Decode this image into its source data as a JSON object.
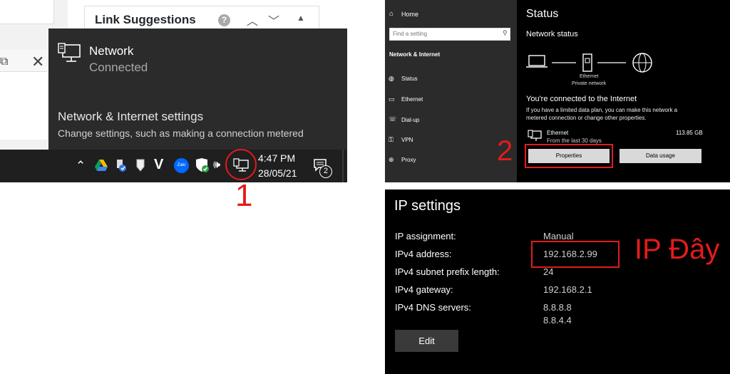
{
  "panel1": {
    "link_suggestions_title": "Link Suggestions",
    "help_icon": "?",
    "flyout": {
      "network_title": "Network",
      "network_status": "Connected",
      "settings_link": "Network & Internet settings",
      "settings_sub": "Change settings, such as making a connection metered"
    },
    "taskbar": {
      "time": "4:47 PM",
      "date": "28/05/21",
      "notification_count": "2"
    },
    "step_label": "1"
  },
  "panel2": {
    "sidebar": {
      "home": "Home",
      "search_placeholder": "Find a setting",
      "section_title": "Network & Internet",
      "items": [
        {
          "label": "Status",
          "icon": "status-icon"
        },
        {
          "label": "Ethernet",
          "icon": "ethernet-icon"
        },
        {
          "label": "Dial-up",
          "icon": "dialup-icon"
        },
        {
          "label": "VPN",
          "icon": "vpn-icon"
        },
        {
          "label": "Proxy",
          "icon": "proxy-icon"
        }
      ]
    },
    "main": {
      "title": "Status",
      "network_status": "Network status",
      "ethernet_caption": "Ethernet",
      "network_type": "Private network",
      "connected_title": "You're connected to the Internet",
      "connected_sub": "If you have a limited data plan, you can make this network a metered connection or change other properties.",
      "adapter_name": "Ethernet",
      "adapter_since": "From the last 30 days",
      "adapter_usage": "113.85 GB",
      "properties_button": "Properties",
      "data_usage_button": "Data usage"
    },
    "step_label": "2"
  },
  "panel3": {
    "title": "IP settings",
    "rows": [
      {
        "label": "IP assignment:",
        "value": "Manual"
      },
      {
        "label": "IPv4 address:",
        "value": "192.168.2.99"
      },
      {
        "label": "IPv4 subnet prefix length:",
        "value": "24"
      },
      {
        "label": "IPv4 gateway:",
        "value": "192.168.2.1"
      },
      {
        "label": "IPv4 DNS servers:",
        "value": "8.8.8.8"
      }
    ],
    "dns_secondary": "8.8.4.4",
    "edit_button": "Edit",
    "annotation": "IP Đây"
  },
  "colors": {
    "annotation_red": "#e31b1b",
    "flyout_bg": "#2b2b2b",
    "settings_bg": "#000000"
  }
}
